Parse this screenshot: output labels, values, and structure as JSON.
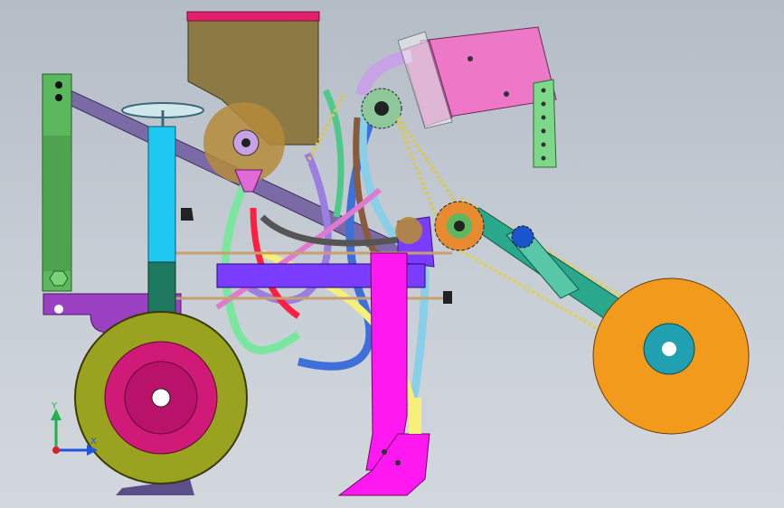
{
  "viewport": {
    "background_top": "#b4bcc6",
    "background_bottom": "#d3d8de"
  },
  "triad": {
    "y_label": "Y",
    "x_label": "X",
    "y_color": "#22b04a",
    "x_color": "#2255dd",
    "z_color": "#e02020"
  },
  "model": {
    "hopper_color": "#8c7a45",
    "hopper_lid_color": "#e0206a",
    "motor_color": "#ee78c8",
    "frame_beam_color": "#7a6aa5",
    "left_post_color": "#5cb85c",
    "blue_post_color": "#1ec8f0",
    "crossbar_color": "#7a3cff",
    "opener_color": "#ff18f0",
    "tire_color": "#9aa320",
    "rim_color": "#d01a78",
    "press_wheel_color": "#f29a1c",
    "press_hub_color": "#20a0b0",
    "arm_color": "#2aa88c",
    "green_arm_color": "#4aa57a",
    "sprocket_color": "#e88a30",
    "small_sprocket_color": "#1a55cc",
    "bracket_purple_color": "#9a40c0",
    "light_green_bracket_color": "#6ee07e"
  }
}
